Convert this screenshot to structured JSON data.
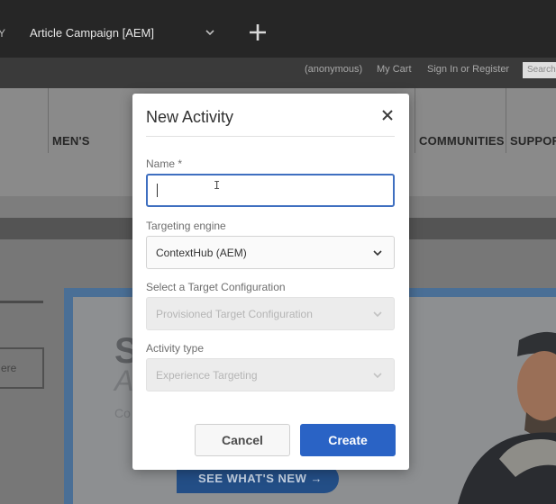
{
  "topbar": {
    "edge_text": "Y",
    "campaign": "Article Campaign [AEM]",
    "icons": {
      "dropdown": "chevron-down-icon",
      "add": "plus-icon"
    }
  },
  "site_header": {
    "anonymous": "(anonymous)",
    "my_cart": "My Cart",
    "sign_in": "Sign In or Register",
    "search_placeholder": "Search"
  },
  "site_nav": {
    "mens": "MEN'S",
    "communities": "COMMUNITIES",
    "support": "SUPPOR"
  },
  "page": {
    "ghost_button": "ere",
    "hero_s": "S",
    "hero_a": "A",
    "hero_c": "Co",
    "see_whats_new": "SEE WHAT'S NEW →"
  },
  "modal": {
    "title": "New Activity",
    "close_icon": "close-icon",
    "name_label": "Name *",
    "name_value": "",
    "targeting_engine_label": "Targeting engine",
    "targeting_engine_value": "ContextHub (AEM)",
    "target_config_label": "Select a Target Configuration",
    "target_config_value": "Provisioned Target Configuration",
    "activity_type_label": "Activity type",
    "activity_type_value": "Experience Targeting",
    "cancel_label": "Cancel",
    "create_label": "Create"
  },
  "colors": {
    "primary": "#2a63c5",
    "focus": "#3f6fc0",
    "topbar": "#262626"
  }
}
